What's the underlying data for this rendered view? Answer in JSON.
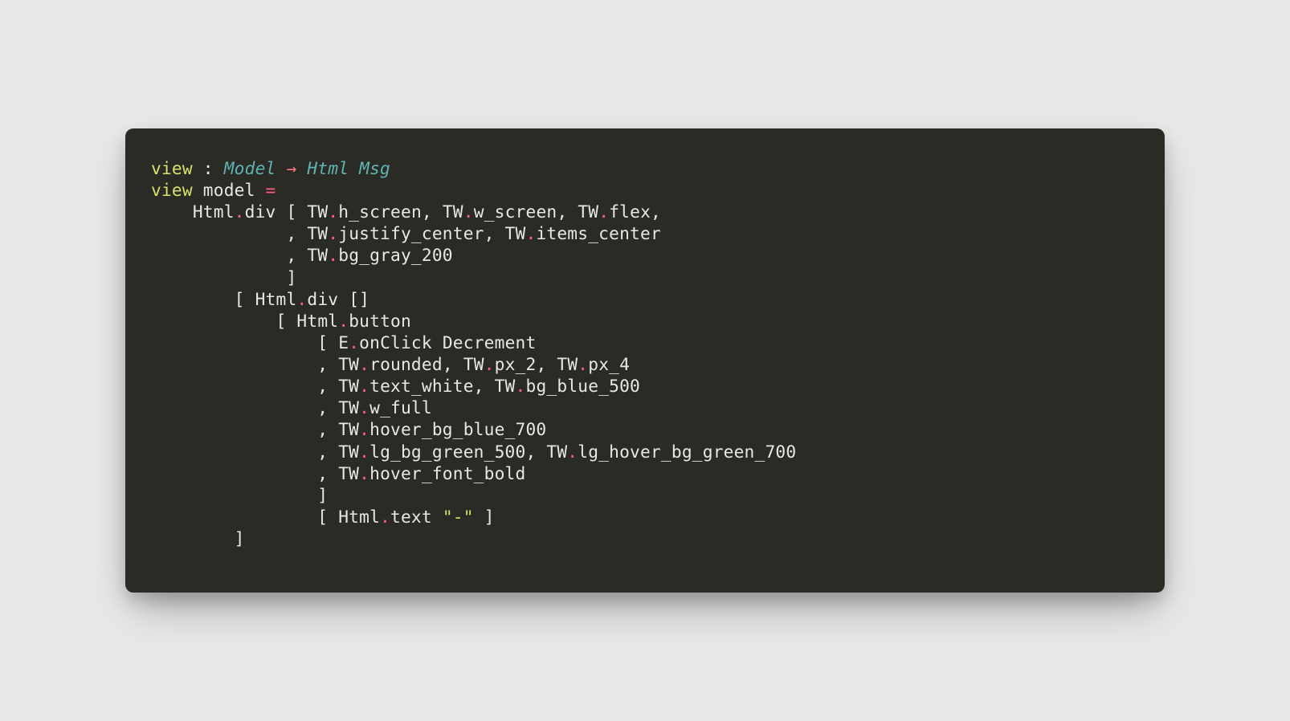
{
  "code": {
    "line1": {
      "fn_name": "view",
      "colon": " : ",
      "type1": "Model",
      "arrow": " → ",
      "type2": "Html Msg"
    },
    "line2": {
      "fn_name": "view",
      "param": " model ",
      "eq": "="
    },
    "line3": {
      "indent": "    ",
      "mod": "Html",
      "dot": ".",
      "fn": "div",
      "open": " [ ",
      "tw1": "TW",
      "dot1": ".",
      "attr1": "h_screen",
      "c1": ", ",
      "tw2": "TW",
      "dot2": ".",
      "attr2": "w_screen",
      "c2": ", ",
      "tw3": "TW",
      "dot3": ".",
      "attr3": "flex",
      "c3": ","
    },
    "line4": {
      "indent": "             , ",
      "tw1": "TW",
      "dot1": ".",
      "attr1": "justify_center",
      "c1": ", ",
      "tw2": "TW",
      "dot2": ".",
      "attr2": "items_center"
    },
    "line5": {
      "indent": "             , ",
      "tw1": "TW",
      "dot1": ".",
      "attr1": "bg_gray_200"
    },
    "line6": {
      "indent": "             ",
      "close": "]"
    },
    "line7": {
      "indent": "        ",
      "open": "[ ",
      "mod": "Html",
      "dot": ".",
      "fn": "div",
      "brackets": " []"
    },
    "line8": {
      "indent": "            ",
      "open": "[ ",
      "mod": "Html",
      "dot": ".",
      "fn": "button"
    },
    "line9": {
      "indent": "                ",
      "open": "[ ",
      "mod": "E",
      "dot": ".",
      "fn": "onClick",
      "sp": " ",
      "variant": "Decrement"
    },
    "line10": {
      "indent": "                , ",
      "tw1": "TW",
      "dot1": ".",
      "attr1": "rounded",
      "c1": ", ",
      "tw2": "TW",
      "dot2": ".",
      "attr2": "px_2",
      "c2": ", ",
      "tw3": "TW",
      "dot3": ".",
      "attr3": "px_4"
    },
    "line11": {
      "indent": "                , ",
      "tw1": "TW",
      "dot1": ".",
      "attr1": "text_white",
      "c1": ", ",
      "tw2": "TW",
      "dot2": ".",
      "attr2": "bg_blue_500"
    },
    "line12": {
      "indent": "                , ",
      "tw1": "TW",
      "dot1": ".",
      "attr1": "w_full"
    },
    "line13": {
      "indent": "                , ",
      "tw1": "TW",
      "dot1": ".",
      "attr1": "hover_bg_blue_700"
    },
    "line14": {
      "indent": "                , ",
      "tw1": "TW",
      "dot1": ".",
      "attr1": "lg_bg_green_500",
      "c1": ", ",
      "tw2": "TW",
      "dot2": ".",
      "attr2": "lg_hover_bg_green_700"
    },
    "line15": {
      "indent": "                , ",
      "tw1": "TW",
      "dot1": ".",
      "attr1": "hover_font_bold"
    },
    "line16": {
      "indent": "                ",
      "close": "]"
    },
    "line17": {
      "indent": "                ",
      "open": "[ ",
      "mod": "Html",
      "dot": ".",
      "fn": "text",
      "sp": " ",
      "str": "\"-\"",
      "close": " ]"
    },
    "line18": {
      "indent": "        ",
      "close": "]"
    }
  }
}
